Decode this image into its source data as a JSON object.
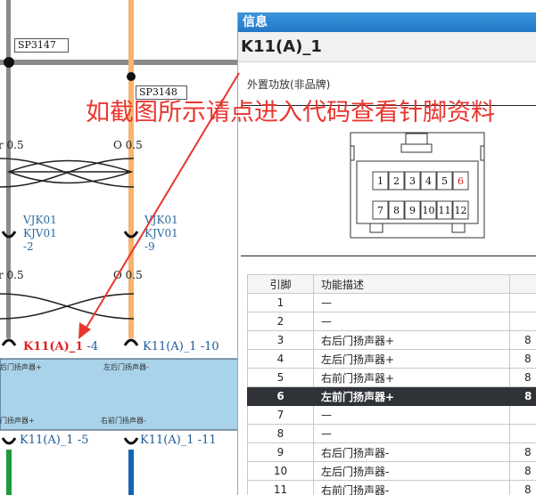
{
  "schematic": {
    "splices": [
      "SP3147",
      "SP3148"
    ],
    "wire_labels": {
      "left_top": "r 0.5",
      "right_top": "O 0.5",
      "left_mid": "r 0.5",
      "right_mid": "O 0.5"
    },
    "connectors": {
      "left": "VJK01\nKJV01\n-2",
      "right": "VJK01\nKJV01\n-9"
    },
    "pins": {
      "p1_name": "K11(A)_1",
      "p1_num": "-4",
      "p2": "K11(A)_1  -10",
      "p3": "K11(A)_1  -5",
      "p4": "K11(A)_1  -11"
    },
    "module_texts": {
      "t1": "后门扬声器+",
      "t2": "左后门扬声器-",
      "t3": "门扬声器+",
      "t4": "右前门扬声器-"
    },
    "wire_colors": {
      "grey": "#888888",
      "orange": "#f7b46e",
      "green": "#1d9a3c",
      "blue": "#1565b3",
      "module": "#a9d3ea"
    }
  },
  "info": {
    "window_title": "信息",
    "header": "K11(A)_1",
    "subtitle": "外置功放(非品牌)",
    "connector_top_row": [
      "1",
      "2",
      "3",
      "4",
      "5",
      "6"
    ],
    "connector_bottom_row": [
      "7",
      "8",
      "9",
      "10",
      "11",
      "12"
    ],
    "highlight_pin_color": "#d42020",
    "table": {
      "headers": [
        "引脚",
        "功能描述",
        ""
      ],
      "rows": [
        {
          "pin": "1",
          "desc": "—",
          "extra": ""
        },
        {
          "pin": "2",
          "desc": "—",
          "extra": ""
        },
        {
          "pin": "3",
          "desc": "右后门扬声器+",
          "extra": "8"
        },
        {
          "pin": "4",
          "desc": "左后门扬声器+",
          "extra": "8"
        },
        {
          "pin": "5",
          "desc": "右前门扬声器+",
          "extra": "8"
        },
        {
          "pin": "6",
          "desc": "左前门扬声器+",
          "extra": "8"
        },
        {
          "pin": "7",
          "desc": "—",
          "extra": ""
        },
        {
          "pin": "8",
          "desc": "—",
          "extra": ""
        },
        {
          "pin": "9",
          "desc": "右后门扬声器-",
          "extra": "8"
        },
        {
          "pin": "10",
          "desc": "左后门扬声器-",
          "extra": "8"
        },
        {
          "pin": "11",
          "desc": "右前门扬声器-",
          "extra": "8"
        }
      ],
      "selected_pin": "6"
    }
  },
  "annotation": {
    "text": "如截图所示请点进入代码查看针脚资料",
    "color": "#e8362f"
  }
}
